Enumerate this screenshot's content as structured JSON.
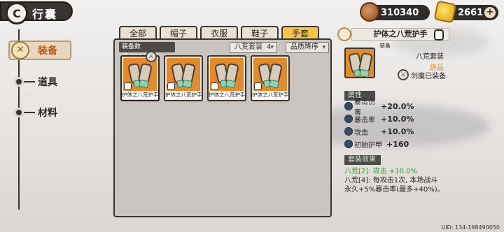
{
  "header": {
    "title": "行囊",
    "back_glyph": "C"
  },
  "currency": {
    "coins": "310340",
    "gold": "2661",
    "plus": "+"
  },
  "nav": {
    "active": {
      "label": "装备",
      "icon_glyph": "✕"
    },
    "items": [
      {
        "label": "道具"
      },
      {
        "label": "材料"
      }
    ]
  },
  "tabs": [
    {
      "label": "全部"
    },
    {
      "label": "帽子"
    },
    {
      "label": "衣服"
    },
    {
      "label": "鞋子"
    },
    {
      "label": "手套"
    }
  ],
  "inventory": {
    "count_label": "装备数量:230/600",
    "set_filter": "八荒套装",
    "set_filter_count": "4",
    "sort_filter": "品质降序",
    "items": [
      {
        "name": "护体之八荒护手",
        "equipped": true
      },
      {
        "name": "护体之八荒护手"
      },
      {
        "name": "护体之八荒护手"
      },
      {
        "name": "护体之八荒护手"
      }
    ]
  },
  "detail": {
    "title": "护体之八荒护手",
    "category": "装备",
    "set_name": "八荒套装",
    "grade": "绝品",
    "equipped_by": "剑魔已装备",
    "attr_header": "属性",
    "stats": [
      {
        "name": "暴击伤害",
        "value": "+20.0%"
      },
      {
        "name": "暴击率",
        "value": "+10.0%"
      },
      {
        "name": "攻击",
        "value": "+10.0%"
      },
      {
        "name": "初始护甲",
        "value": "+160"
      }
    ],
    "set_header": "套装效果",
    "set_effects": [
      "八荒[2]: 攻击 +10.0%",
      "八荒[4]: 每攻击1次, 本场战斗",
      "永久+5%暴击率(最多+40%)。"
    ]
  },
  "footer": {
    "uid": "UID: 134-198490050"
  }
}
